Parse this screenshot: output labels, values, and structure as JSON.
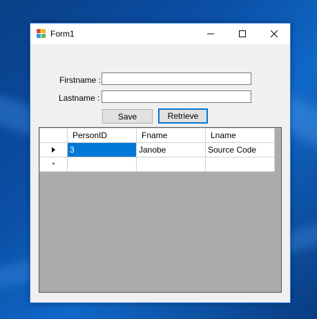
{
  "window": {
    "title": "Form1",
    "icon": "form-app-icon",
    "controls": {
      "minimize": "minimize-icon",
      "maximize": "maximize-icon",
      "close": "close-icon"
    }
  },
  "form": {
    "firstname_label": "Firstname :",
    "firstname_value": "",
    "lastname_label": "Lastname :",
    "lastname_value": "",
    "save_label": "Save",
    "retrieve_label": "Retrieve"
  },
  "grid": {
    "columns": [
      "PersonID",
      "Fname",
      "Lname"
    ],
    "rows": [
      {
        "PersonID": "3",
        "Fname": "Janobe",
        "Lname": "Source Code"
      }
    ],
    "new_row_marker": "*",
    "current_row_icon": "row-pointer-icon"
  },
  "colors": {
    "accent": "#0078d7",
    "grid_background": "#ababab"
  }
}
